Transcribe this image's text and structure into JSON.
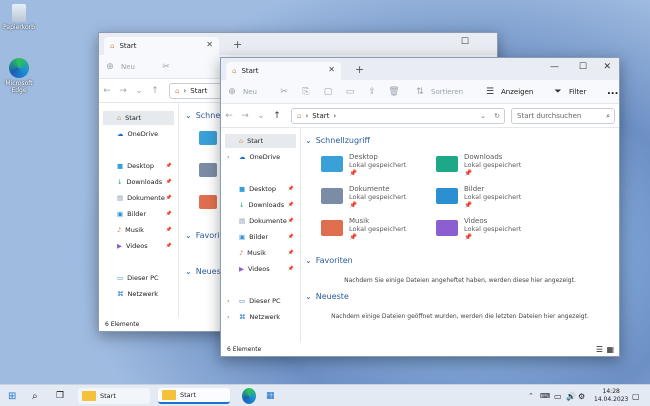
{
  "desktop": {
    "recycle": "Papierkorb",
    "edge": "Microsoft Edge"
  },
  "back": {
    "tab": "Start",
    "new": "Neu",
    "address": "Start",
    "sidebar": [
      "Start",
      "OneDrive",
      "Desktop",
      "Downloads",
      "Dokumente",
      "Bilder",
      "Musik",
      "Videos",
      "Dieser PC",
      "Netzwerk"
    ],
    "sections": [
      "Schnellzugriff",
      "Favoriten",
      "Neueste"
    ],
    "status": "6 Elemente"
  },
  "front": {
    "tab": "Start",
    "new": "Neu",
    "sort": "Sortieren",
    "view": "Anzeigen",
    "filter": "Filter",
    "more": "...",
    "address": "Start",
    "search": "Start durchsuchen",
    "sidebar": [
      "Start",
      "OneDrive",
      "Desktop",
      "Downloads",
      "Dokumente",
      "Bilder",
      "Musik",
      "Videos",
      "Dieser PC",
      "Netzwerk"
    ],
    "quick_title": "Schnellzugriff",
    "folders": [
      {
        "name": "Desktop",
        "sub": "Lokal gespeichert",
        "color": "#3aa0d8"
      },
      {
        "name": "Downloads",
        "sub": "Lokal gespeichert",
        "color": "#1fa888"
      },
      {
        "name": "Dokumente",
        "sub": "Lokal gespeichert",
        "color": "#7b8da6"
      },
      {
        "name": "Bilder",
        "sub": "Lokal gespeichert",
        "color": "#2b8fd1"
      },
      {
        "name": "Musik",
        "sub": "Lokal gespeichert",
        "color": "#e06f4f"
      },
      {
        "name": "Videos",
        "sub": "Lokal gespeichert",
        "color": "#8b5fcf"
      }
    ],
    "fav_title": "Favoriten",
    "fav_empty": "Nachdem Sie einige Dateien angeheftet haben, werden diese hier angezeigt.",
    "recent_title": "Neueste",
    "recent_empty": "Nachdem einige Dateien geöffnet wurden, werden die letzten Dateien hier angezeigt.",
    "status": "6 Elemente"
  },
  "taskbar": {
    "app1": "Start",
    "app2": "Start",
    "time": "14:28",
    "date": "14.04.2023"
  }
}
